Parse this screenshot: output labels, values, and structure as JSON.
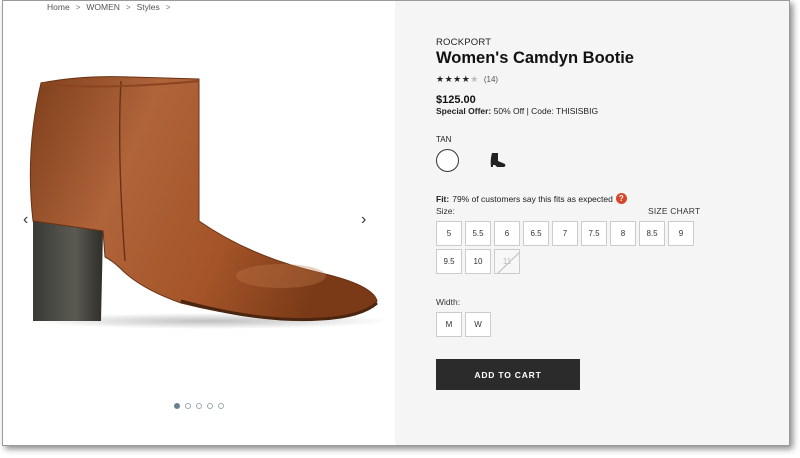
{
  "breadcrumb": {
    "items": [
      "Home",
      "WOMEN",
      "Styles"
    ],
    "separator": ">"
  },
  "gallery": {
    "prev_arrow": "‹",
    "next_arrow": "›",
    "dot_count": 5,
    "active_dot": 1
  },
  "product": {
    "brand": "ROCKPORT",
    "title": "Women's Camdyn Bootie",
    "rating": 4,
    "rating_max": 5,
    "stars_on": "★★★★",
    "stars_off": "★",
    "review_count": "(14)",
    "price": "$125.00",
    "offer_label": "Special Offer:",
    "offer_text": "50% Off | Code: THISISBIG"
  },
  "color": {
    "label": "TAN"
  },
  "fit": {
    "label": "Fit:",
    "text": "79% of customers say this fits as expected",
    "help_icon": "?"
  },
  "size": {
    "label": "Size:",
    "chart_link": "SIZE CHART",
    "options": [
      "5",
      "5.5",
      "6",
      "6.5",
      "7",
      "7.5",
      "8",
      "8.5",
      "9",
      "9.5",
      "10",
      "11"
    ],
    "unavailable": [
      "11"
    ]
  },
  "width": {
    "label": "Width:",
    "options": [
      "M",
      "W"
    ]
  },
  "cart": {
    "button_label": "ADD TO CART"
  },
  "colors": {
    "panel_bg": "#f5f5f5",
    "button_bg": "#2b2b2b",
    "help_badge": "#d6462a",
    "boot_leather": "#a8582c"
  }
}
